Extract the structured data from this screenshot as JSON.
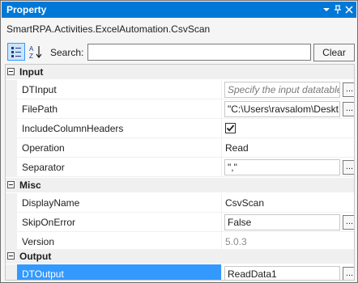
{
  "window": {
    "title": "Property",
    "pin_glyph": "▼ ⊥ ✕"
  },
  "activity_type": "SmartRPA.Activities.ExcelAutomation.CsvScan",
  "toolbar": {
    "categorized_icon": "categorized-icon",
    "alphabetical_icon": "sort-az-icon",
    "search_label": "Search:",
    "search_value": "",
    "clear_label": "Clear"
  },
  "categories": {
    "input": "Input",
    "misc": "Misc",
    "output": "Output"
  },
  "properties": {
    "dtinput": {
      "name": "DTInput",
      "placeholder": "Specify the input datatable"
    },
    "filepath": {
      "name": "FilePath",
      "value": "\"C:\\Users\\ravsalom\\Deskt"
    },
    "includecolumnheaders": {
      "name": "IncludeColumnHeaders",
      "checked": true
    },
    "operation": {
      "name": "Operation",
      "value": "Read"
    },
    "separator": {
      "name": "Separator",
      "value": "\",\""
    },
    "displayname": {
      "name": "DisplayName",
      "value": "CsvScan"
    },
    "skiponerror": {
      "name": "SkipOnError",
      "value": "False"
    },
    "version": {
      "name": "Version",
      "value": "5.0.3"
    },
    "dtoutput": {
      "name": "DTOutput",
      "value": "ReadData1"
    }
  },
  "ellipsis_label": "...",
  "colors": {
    "titlebar": "#0078d7",
    "selection": "#3399ff",
    "category_bg": "#f0f0f0"
  }
}
